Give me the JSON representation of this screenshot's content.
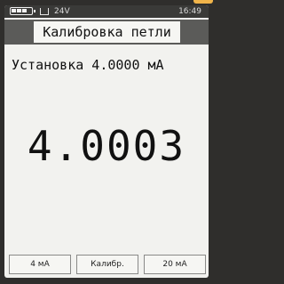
{
  "status_bar": {
    "voltage": "24V",
    "time": "16:49",
    "battery_level": 1.0,
    "battery_icon": "battery-icon",
    "loop_icon": "loop-power-icon"
  },
  "title": "Калибровка петли",
  "setpoint_text": "Установка 4.0000 мА",
  "reading": "4.0003",
  "softkeys": [
    {
      "label": "4 мА"
    },
    {
      "label": "Калибр."
    },
    {
      "label": "20 мА"
    }
  ],
  "colors": {
    "accent": "#f0b44a",
    "bezel": "#2f2e2c",
    "screen": "#f2f2ef"
  }
}
